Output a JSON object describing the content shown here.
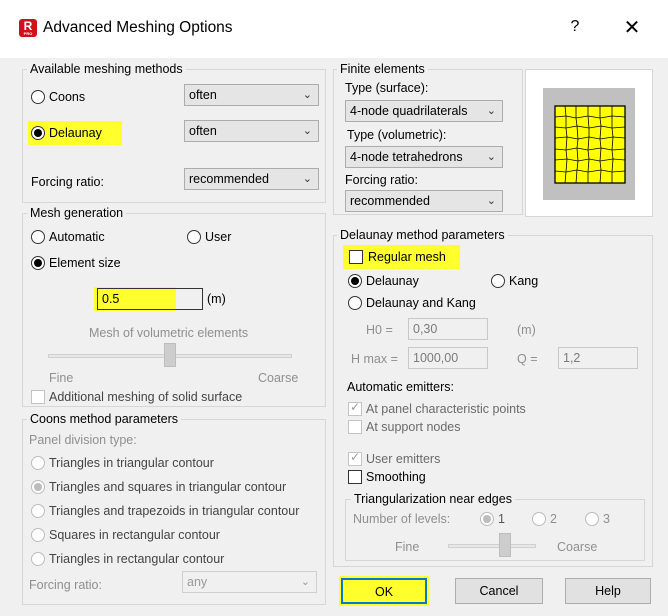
{
  "window": {
    "title": "Advanced Meshing Options",
    "app_icon_letter": "R",
    "app_icon_sub": "PRO",
    "help_glyph": "?",
    "close_glyph": "✕"
  },
  "meshing_methods": {
    "legend": "Available meshing methods",
    "coons_label": "Coons",
    "coons_combo": "often",
    "delaunay_label": "Delaunay",
    "delaunay_combo": "often",
    "forcing_label": "Forcing ratio:",
    "forcing_combo": "recommended"
  },
  "mesh_generation": {
    "legend": "Mesh generation",
    "automatic_label": "Automatic",
    "user_label": "User",
    "element_size_label": "Element size",
    "element_size_value": "0.5",
    "element_size_unit": "(m)",
    "volumetric_label": "Mesh of volumetric elements",
    "fine_label": "Fine",
    "coarse_label": "Coarse",
    "additional_label": "Additional meshing of solid surface"
  },
  "coons_params": {
    "legend": "Coons method parameters",
    "panel_division_label": "Panel division type:",
    "options": [
      "Triangles in triangular contour",
      "Triangles and squares in triangular contour",
      "Triangles and trapezoids in triangular contour",
      "Squares in rectangular contour",
      "Triangles in rectangular contour"
    ],
    "forcing_label": "Forcing ratio:",
    "forcing_combo": "any"
  },
  "finite_elements": {
    "legend": "Finite elements",
    "surface_label": "Type (surface):",
    "surface_combo": "4-node quadrilaterals",
    "volumetric_label": "Type (volumetric):",
    "volumetric_combo": "4-node tetrahedrons",
    "forcing_label": "Forcing ratio:",
    "forcing_combo": "recommended"
  },
  "delaunay_params": {
    "legend": "Delaunay method parameters",
    "regular_mesh_label": "Regular mesh",
    "delaunay_label": "Delaunay",
    "kang_label": "Kang",
    "delaunay_kang_label": "Delaunay and Kang",
    "h0_label": "H0 =",
    "h0_value": "0,30",
    "h0_unit": "(m)",
    "hmax_label": "H max =",
    "hmax_value": "1000,00",
    "q_label": "Q =",
    "q_value": "1,2",
    "auto_emitters_label": "Automatic emitters:",
    "panel_points_label": "At panel characteristic points",
    "support_nodes_label": "At support nodes",
    "user_emitters_label": "User emitters",
    "smoothing_label": "Smoothing",
    "near_edges_legend": "Triangularization near edges",
    "levels_label": "Number of levels:",
    "level_options": [
      "1",
      "2",
      "3"
    ],
    "fine_label": "Fine",
    "coarse_label": "Coarse"
  },
  "buttons": {
    "ok": "OK",
    "cancel": "Cancel",
    "help": "Help"
  },
  "colors": {
    "highlight": "#ffff2e",
    "mesh_fill": "#ffff00",
    "accent": "#0078d7",
    "app_icon": "#d0101a"
  }
}
